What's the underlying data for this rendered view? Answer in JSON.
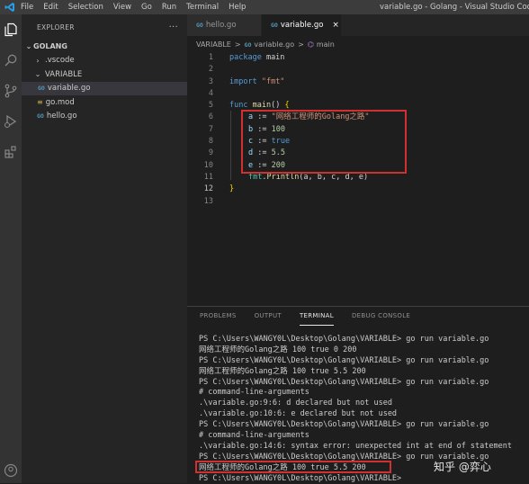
{
  "titlebar": {
    "menu": [
      "File",
      "Edit",
      "Selection",
      "View",
      "Go",
      "Run",
      "Terminal",
      "Help"
    ],
    "window_title": "variable.go - Golang - Visual Studio Code"
  },
  "explorer": {
    "title": "EXPLORER",
    "more": "···",
    "root": "GOLANG",
    "items": [
      {
        "label": ".vscode",
        "chevron": "›"
      },
      {
        "label": "VARIABLE",
        "chevron": "⌄"
      },
      {
        "label": "variable.go",
        "badge": "GO"
      },
      {
        "label": "go.mod",
        "badge": "≡"
      },
      {
        "label": "hello.go",
        "badge": "GO"
      }
    ]
  },
  "tabs": [
    {
      "badge": "GO",
      "label": "hello.go"
    },
    {
      "badge": "GO",
      "label": "variable.go",
      "close": "×"
    }
  ],
  "breadcrumb": {
    "folder": "VARIABLE",
    "sep1": ">",
    "file": "variable.go",
    "sep2": ">",
    "symbol": "main"
  },
  "code": {
    "line_numbers": [
      "1",
      "2",
      "3",
      "4",
      "5",
      "6",
      "7",
      "8",
      "9",
      "10",
      "11",
      "12",
      "13"
    ],
    "l1": {
      "kw": "package",
      "name": " main"
    },
    "l3": {
      "kw": "import",
      "str": " \"fmt\""
    },
    "l5": {
      "kw": "func",
      "fn": " main",
      "rest": "() ",
      "brace": "{"
    },
    "l6": {
      "var": "a",
      "op": " := ",
      "str": "\"网络工程师的Golang之路\""
    },
    "l7": {
      "var": "b",
      "op": " := ",
      "num": "100"
    },
    "l8": {
      "var": "c",
      "op": " := ",
      "kw": "true"
    },
    "l9": {
      "var": "d",
      "op": " := ",
      "num": "5.5"
    },
    "l10": {
      "var": "e",
      "op": " := ",
      "num": "200"
    },
    "l11": {
      "pkg": "fmt",
      "dot": ".",
      "fn": "Println",
      "args": "(a, b, c, d, e)"
    },
    "l12": {
      "brace": "}"
    }
  },
  "panel": {
    "tabs": [
      "PROBLEMS",
      "OUTPUT",
      "TERMINAL",
      "DEBUG CONSOLE"
    ],
    "terminal_lines": [
      "PS C:\\Users\\WANGY0L\\Desktop\\Golang\\VARIABLE> go run variable.go",
      "网络工程师的Golang之路 100 true 0 200",
      "PS C:\\Users\\WANGY0L\\Desktop\\Golang\\VARIABLE> go run variable.go",
      "网络工程师的Golang之路 100 true 5.5 200",
      "PS C:\\Users\\WANGY0L\\Desktop\\Golang\\VARIABLE> go run variable.go",
      "# command-line-arguments",
      ".\\variable.go:9:6: d declared but not used",
      ".\\variable.go:10:6: e declared but not used",
      "PS C:\\Users\\WANGY0L\\Desktop\\Golang\\VARIABLE> go run variable.go",
      "# command-line-arguments",
      ".\\variable.go:14:6: syntax error: unexpected int at end of statement",
      "PS C:\\Users\\WANGY0L\\Desktop\\Golang\\VARIABLE> go run variable.go",
      "网络工程师的Golang之路 100 true 5.5 200",
      "PS C:\\Users\\WANGY0L\\Desktop\\Golang\\VARIABLE> "
    ]
  },
  "watermark": "知乎 @弈心",
  "colors": {
    "highlight_box": "#d0302f",
    "accent": "#007acc"
  }
}
